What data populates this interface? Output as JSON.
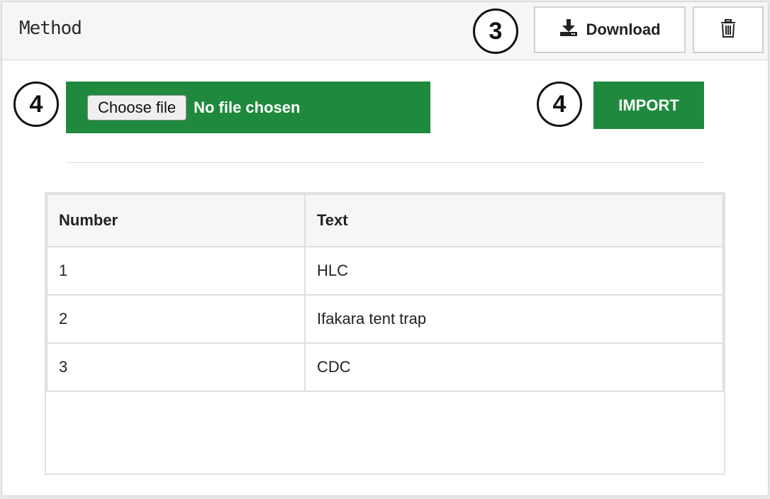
{
  "header": {
    "title": "Method",
    "download_label": "Download",
    "download_icon": "download-icon",
    "delete_icon": "trash-icon"
  },
  "markers": {
    "download": "3",
    "file": "4",
    "import": "4"
  },
  "upload": {
    "choose_label": "Choose file",
    "status": "No file chosen",
    "import_label": "IMPORT"
  },
  "colors": {
    "accent_green": "#1f8a3e",
    "header_bg": "#f6f6f6"
  },
  "table": {
    "headers": [
      "Number",
      "Text"
    ],
    "rows": [
      [
        "1",
        "HLC"
      ],
      [
        "2",
        "Ifakara tent trap"
      ],
      [
        "3",
        "CDC"
      ]
    ]
  }
}
